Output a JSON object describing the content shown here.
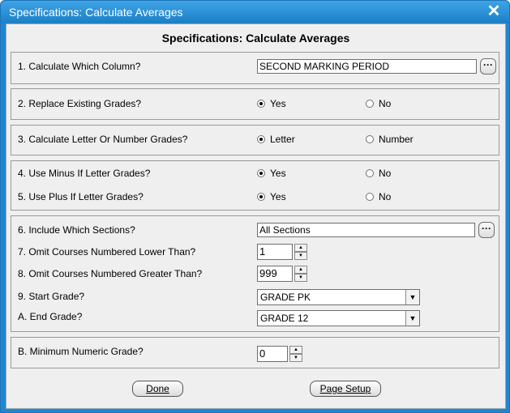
{
  "window": {
    "title": "Specifications: Calculate Averages",
    "close_symbol": "✕"
  },
  "form": {
    "heading": "Specifications: Calculate Averages",
    "q1": {
      "label": "1. Calculate Which Column?",
      "value": "SECOND MARKING PERIOD",
      "button": "···"
    },
    "q2": {
      "label": "2. Replace Existing Grades?",
      "opt_a": "Yes",
      "opt_b": "No",
      "selected": "Yes"
    },
    "q3": {
      "label": "3. Calculate Letter Or Number Grades?",
      "opt_a": "Letter",
      "opt_b": "Number",
      "selected": "Letter"
    },
    "q4": {
      "label": "4. Use Minus If Letter Grades?",
      "opt_a": "Yes",
      "opt_b": "No",
      "selected": "Yes"
    },
    "q5": {
      "label": "5. Use Plus If Letter Grades?",
      "opt_a": "Yes",
      "opt_b": "No",
      "selected": "Yes"
    },
    "q6": {
      "label": "6. Include Which Sections?",
      "value": "All Sections",
      "button": "···"
    },
    "q7": {
      "label": "7. Omit Courses Numbered Lower Than?",
      "value": "1"
    },
    "q8": {
      "label": "8. Omit Courses Numbered Greater Than?",
      "value": "999"
    },
    "q9": {
      "label": "9. Start Grade?",
      "value": "GRADE PK"
    },
    "qA": {
      "label": "A. End Grade?",
      "value": "GRADE 12"
    },
    "qB": {
      "label": "B. Minimum Numeric Grade?",
      "value": "0"
    }
  },
  "buttons": {
    "done": "Done",
    "page_setup": "Page Setup"
  }
}
